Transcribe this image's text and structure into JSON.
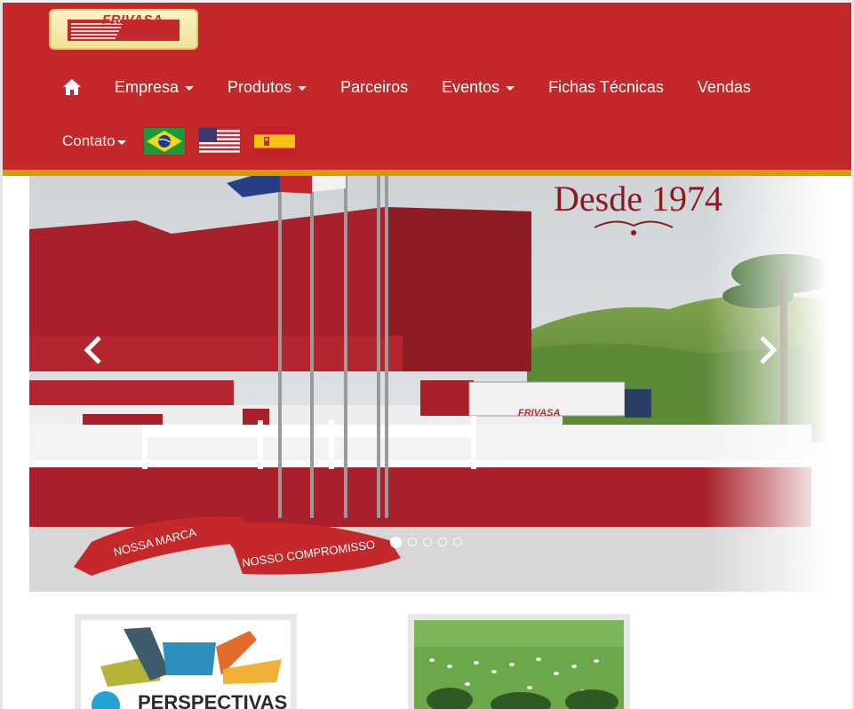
{
  "brand": {
    "logo_text": "FRIVASA"
  },
  "nav": {
    "home_icon": "home-icon",
    "items": [
      {
        "label": "Empresa",
        "dropdown": true
      },
      {
        "label": "Produtos",
        "dropdown": true
      },
      {
        "label": "Parceiros",
        "dropdown": false
      },
      {
        "label": "Eventos",
        "dropdown": true
      },
      {
        "label": "Fichas Técnicas",
        "dropdown": false
      },
      {
        "label": "Vendas",
        "dropdown": false
      }
    ],
    "contato": "Contato",
    "languages": [
      "Português (Brasil)",
      "English",
      "Español"
    ]
  },
  "carousel": {
    "headline": "Desde 1974",
    "ribbon_left": "NOSSA MARCA",
    "ribbon_right": "NOSSO COMPROMISSO",
    "truck_label": "FRIVASA",
    "slide_count": 5,
    "active_slide": 1,
    "prev_icon": "chevron-left-icon",
    "next_icon": "chevron-right-icon"
  },
  "thumbs": [
    {
      "title": "PERSPECTIVAS"
    },
    {
      "title": ""
    }
  ],
  "colors": {
    "header_red": "#c4282a",
    "header_border": "#d99a08",
    "logo_bg": "#f6e8ae",
    "building_red": "#a8202a"
  }
}
